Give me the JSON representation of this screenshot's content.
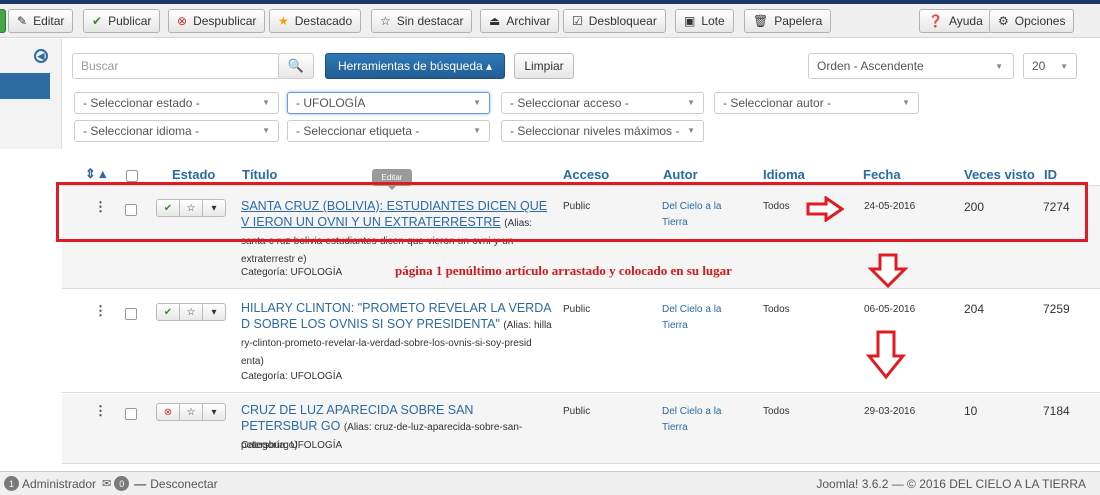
{
  "toolbar": {
    "edit": "Editar",
    "publish": "Publicar",
    "unpublish": "Despublicar",
    "featured": "Destacado",
    "unfeatured": "Sin destacar",
    "archive": "Archivar",
    "checkin": "Desbloquear",
    "batch": "Lote",
    "trash": "Papelera",
    "help": "Ayuda",
    "options": "Opciones"
  },
  "search": {
    "placeholder": "Buscar",
    "tools_label": "Herramientas de búsqueda ▴",
    "clear_label": "Limpiar",
    "ordering": "Orden - Ascendente",
    "limit": "20"
  },
  "filters": {
    "state": "- Seleccionar estado -",
    "category": "- UFOLOGÍA",
    "access": "- Seleccionar acceso -",
    "author": "- Seleccionar autor -",
    "language": "- Seleccionar idioma -",
    "tag": "- Seleccionar etiqueta -",
    "max_levels": "- Seleccionar niveles máximos -"
  },
  "table": {
    "headers": {
      "status": "Estado",
      "title": "Título",
      "access": "Acceso",
      "author": "Autor",
      "language": "Idioma",
      "date": "Fecha",
      "hits": "Veces visto",
      "id": "ID"
    },
    "rows": [
      {
        "title": "SANTA CRUZ (BOLIVIA): ESTUDIANTES DICEN QUE V IERON UN OVNI Y UN EXTRATERRESTRE",
        "alias": "(Alias: santa-c ruz-bolivia-estudiantes-dicen-que-vieron-un-ovni-y-un-extraterrestr e)",
        "category": "Categoría: UFOLOGÍA",
        "access": "Public",
        "author": "Del Cielo a la Tierra",
        "language": "Todos",
        "date": "24-05-2016",
        "hits": "200",
        "id": "7274",
        "status": "published"
      },
      {
        "title": "HILLARY CLINTON: \"PROMETO REVELAR LA VERDA D SOBRE LOS OVNIS SI SOY PRESIDENTA\"",
        "alias": "(Alias: hilla ry-clinton-prometo-revelar-la-verdad-sobre-los-ovnis-si-soy-presid enta)",
        "category": "Categoría: UFOLOGÍA",
        "access": "Public",
        "author": "Del Cielo a la Tierra",
        "language": "Todos",
        "date": "06-05-2016",
        "hits": "204",
        "id": "7259",
        "status": "published"
      },
      {
        "title": "CRUZ DE LUZ APARECIDA SOBRE SAN PETERSBUR GO",
        "alias": "(Alias: cruz-de-luz-aparecida-sobre-san-petersburgo)",
        "category": "Categoría: UFOLOGÍA",
        "access": "Public",
        "author": "Del Cielo a la Tierra",
        "language": "Todos",
        "date": "29-03-2016",
        "hits": "10",
        "id": "7184",
        "status": "unpublished"
      }
    ]
  },
  "tooltip": "Editar",
  "annotation": "página 1 penúltimo artículo arrastado y colocado en su lugar",
  "statusbar": {
    "users_count": "1",
    "user_label": "Administrador",
    "messages_count": "0",
    "logout": "Desconectar",
    "version": "Joomla! 3.6.2 — © 2016 DEL CIELO A LA TIERRA"
  },
  "colors": {
    "accent": "#2b6aa3",
    "annotation_red": "#e01b22",
    "toolbar_bg": "#f0f0f0"
  }
}
